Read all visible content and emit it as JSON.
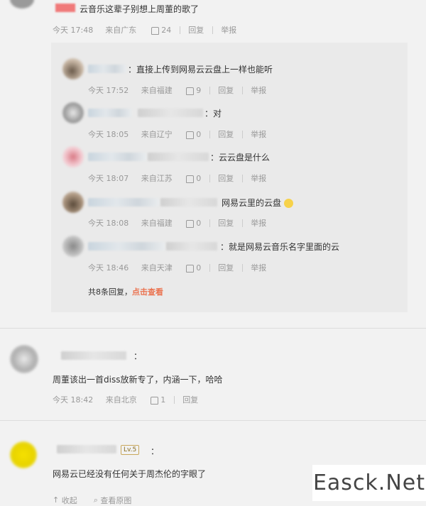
{
  "top_comment": {
    "text": "云音乐这辈子别想上周董的歌了",
    "time": "今天 17:48",
    "location": "来自广东",
    "likes": "24",
    "reply_label": "回复",
    "report_label": "举报"
  },
  "replies": [
    {
      "text": "：直接上传到网易云云盘上一样也能听",
      "time": "今天 17:52",
      "location": "来自福建",
      "likes": "9",
      "reply_label": "回复",
      "report_label": "举报"
    },
    {
      "text": "：对",
      "time": "今天 18:05",
      "location": "来自辽宁",
      "likes": "0",
      "reply_label": "回复",
      "report_label": "举报"
    },
    {
      "text": "：云云盘是什么",
      "time": "今天 18:07",
      "location": "来自江苏",
      "likes": "0",
      "reply_label": "回复",
      "report_label": "举报"
    },
    {
      "text": "网易云里的云盘",
      "time": "今天 18:08",
      "location": "来自福建",
      "likes": "0",
      "reply_label": "回复",
      "report_label": "举报"
    },
    {
      "text": "：就是网易云音乐名字里面的云",
      "time": "今天 18:46",
      "location": "来自天津",
      "likes": "0",
      "reply_label": "回复",
      "report_label": "举报"
    }
  ],
  "more_replies": {
    "count_text": "共8条回复，",
    "link": "点击查看"
  },
  "comment2": {
    "colon": "：",
    "text": "周董该出一首diss放新专了，内涵一下，哈哈",
    "time": "今天 18:42",
    "location": "来自北京",
    "likes": "1",
    "reply_label": "回复"
  },
  "comment3": {
    "level": "Lv.5",
    "colon": "：",
    "text": "网易云已经没有任何关于周杰伦的字眼了",
    "collapse": "收起",
    "view_image": "查看原图"
  },
  "watermark": "Easck.Net",
  "colors": {
    "accent": "#eb7350",
    "background": "#f2f2f2",
    "panel": "#eaeaea"
  }
}
